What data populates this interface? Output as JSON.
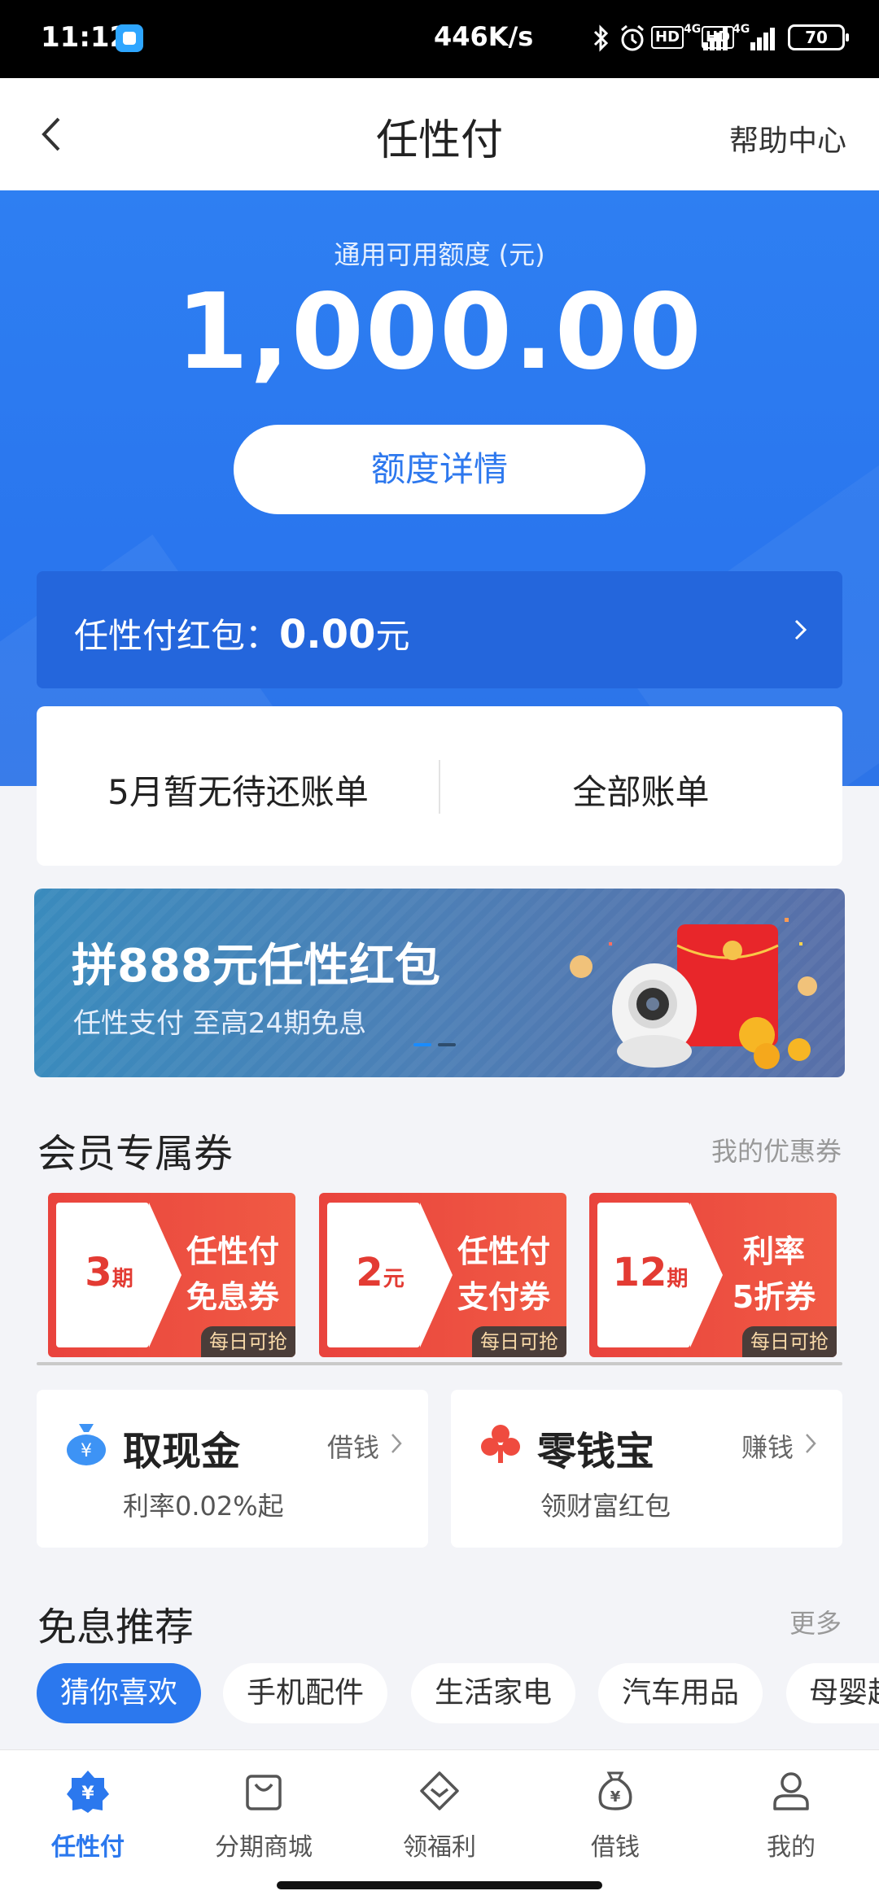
{
  "status_bar": {
    "time": "11:12",
    "net_speed": "446K/s",
    "hd1": "HD",
    "hd2": "HD",
    "net1": "4G",
    "net2": "4G",
    "battery": "70"
  },
  "nav": {
    "title": "任性付",
    "help": "帮助中心"
  },
  "credit": {
    "label": "通用可用额度 (元)",
    "amount": "1,000.00",
    "detail_button": "额度详情"
  },
  "red_packet": {
    "label": "任性付红包：",
    "amount": "0.00",
    "unit": "元"
  },
  "bills": {
    "pending": "5月暂无待还账单",
    "all": "全部账单"
  },
  "banner": {
    "title": "拼888元任性红包",
    "subtitle": "任性支付 至高24期免息",
    "active_dot_color": "#1a8cff"
  },
  "coupons_section": {
    "title": "会员专属券",
    "more": "我的优惠券",
    "items": [
      {
        "num": "3",
        "unit": "期",
        "line1": "任性付",
        "line2": "免息券",
        "tag": "每日可抢"
      },
      {
        "num": "2",
        "unit": "元",
        "line1": "任性付",
        "line2": "支付券",
        "tag": "每日可抢"
      },
      {
        "num": "12",
        "unit": "期",
        "line1": "利率",
        "line2": "5折券",
        "tag": "每日可抢"
      }
    ]
  },
  "services": [
    {
      "icon": "money-bag-icon",
      "title": "取现金",
      "action": "借钱",
      "desc": "利率0.02%起"
    },
    {
      "icon": "clover-icon",
      "title": "零钱宝",
      "action": "赚钱",
      "desc": "领财富红包"
    }
  ],
  "free_interest": {
    "title": "免息推荐",
    "more": "更多",
    "chips": [
      "猜你喜欢",
      "手机配件",
      "生活家电",
      "汽车用品",
      "母婴超"
    ]
  },
  "tabs": [
    {
      "icon": "renxingfu-icon",
      "label": "任性付",
      "active": true
    },
    {
      "icon": "shopping-bag-icon",
      "label": "分期商城",
      "active": false
    },
    {
      "icon": "gift-diamond-icon",
      "label": "领福利",
      "active": false
    },
    {
      "icon": "borrow-money-icon",
      "label": "借钱",
      "active": false
    },
    {
      "icon": "profile-icon",
      "label": "我的",
      "active": false
    }
  ],
  "colors": {
    "brand_blue": "#2b78ee",
    "coupon_red": "#e9433d"
  }
}
